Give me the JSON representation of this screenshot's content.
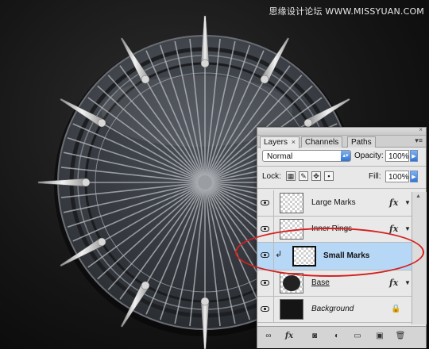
{
  "watermark": "思缘设计论坛 WWW.MISSYUAN.COM",
  "panel": {
    "tabs": [
      {
        "label": "Layers",
        "close": "×",
        "active": true
      },
      {
        "label": "Channels",
        "active": false
      },
      {
        "label": "Paths",
        "active": false
      }
    ],
    "panel_close": "×",
    "menu_icon": "▾≡",
    "blend_mode": "Normal",
    "opacity_label": "Opacity:",
    "opacity_value": "100%",
    "lock_label": "Lock:",
    "fill_label": "Fill:",
    "fill_value": "100%",
    "layers": [
      {
        "name": "Large Marks",
        "thumb": "transparent",
        "fx": "fx",
        "selected": false,
        "clipped": false,
        "locked": false
      },
      {
        "name": "Inner Rings",
        "thumb": "transparent",
        "fx": "fx",
        "selected": false,
        "clipped": false,
        "locked": false
      },
      {
        "name": "Small Marks",
        "thumb": "transparent",
        "fx": "",
        "selected": true,
        "clipped": true,
        "locked": false
      },
      {
        "name": "Base",
        "thumb": "disc",
        "fx": "fx",
        "selected": false,
        "clipped": false,
        "locked": false
      },
      {
        "name": "Background",
        "thumb": "dark",
        "fx": "",
        "selected": false,
        "clipped": false,
        "locked": true
      }
    ],
    "bottom_icons": [
      "link-icon",
      "fx-icon",
      "mask-icon",
      "adjustment-icon",
      "group-icon",
      "new-layer-icon",
      "trash-icon"
    ],
    "fx_text": "fx"
  },
  "colors": {
    "selection": "#b7d7f6",
    "annotation_red": "#d4201f",
    "accent_blue": "#2f75d6"
  }
}
